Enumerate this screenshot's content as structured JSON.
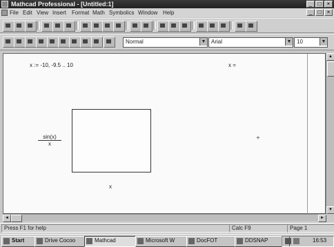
{
  "window": {
    "title": "Mathcad Professional - [Untitled:1]",
    "controls": {
      "minimize": "_",
      "maximize": "□",
      "close": "×"
    }
  },
  "menubar": {
    "items": [
      "File",
      "Edit",
      "View",
      "Insert",
      "Format",
      "Math",
      "Symbolics",
      "Window",
      "Help"
    ],
    "doc_controls": {
      "minimize": "_",
      "restore": "□",
      "close": "×"
    }
  },
  "format_toolbar": {
    "style_value": "Normal",
    "font_value": "Arial",
    "size_value": "10"
  },
  "worksheet": {
    "range_definition": "x := -10, -9.5 .. 10",
    "eval_expr": "x =",
    "plot_y_label_num": "sin(x)",
    "plot_y_label_den": "x",
    "plot_x_label": "x",
    "crosshair": "+"
  },
  "statusbar": {
    "help_text": "Press F1 for help",
    "mode": "Calc F9",
    "page": "Page 1"
  },
  "taskbar": {
    "start_label": "Start",
    "tasks": [
      "Drive Cocoo",
      "Mathcad",
      "Microsoft W",
      "DocFOT",
      "DDSNAP"
    ],
    "clock": "16:53"
  }
}
